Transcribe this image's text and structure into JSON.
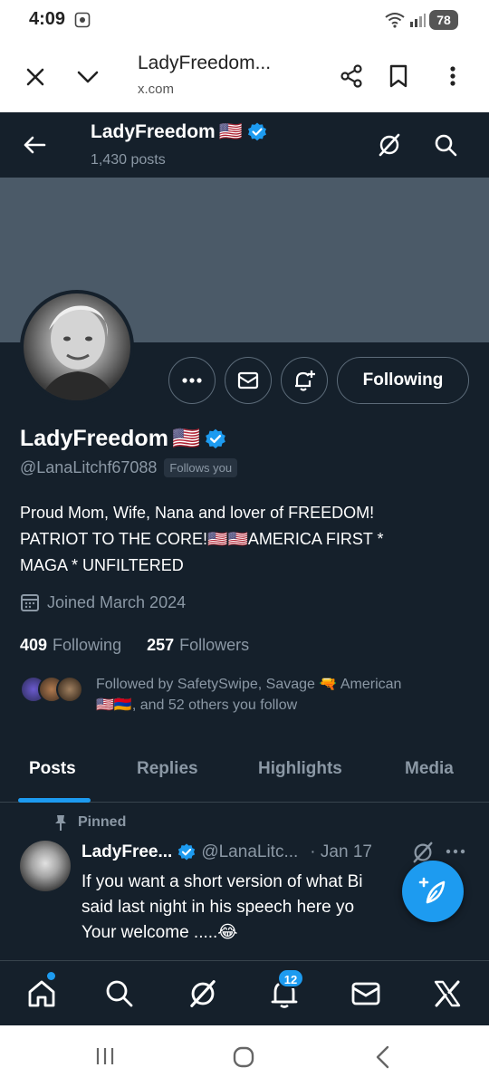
{
  "status_bar": {
    "time": "4:09",
    "battery": "78"
  },
  "browser": {
    "title": "LadyFreedom...",
    "domain": "x.com"
  },
  "top_bar": {
    "name": "LadyFreedom",
    "flag": "🇺🇸",
    "posts_count": "1,430 posts"
  },
  "profile": {
    "name": "LadyFreedom",
    "flag": "🇺🇸",
    "handle": "@LanaLitchf67088",
    "follows_you": "Follows you",
    "bio_line1": "Proud Mom, Wife, Nana and lover of FREEDOM!",
    "bio_line2": "PATRIOT TO THE CORE!🇺🇸🇺🇸AMERICA FIRST *",
    "bio_line3": "MAGA * UNFILTERED",
    "joined": "Joined March 2024",
    "following_count": "409",
    "following_label": "Following",
    "followers_count": "257",
    "followers_label": "Followers",
    "mutuals_line1": "Followed by SafetySwipe, Savage 🔫 American",
    "mutuals_line2": "🇺🇸🇦🇲, and 52 others you follow",
    "follow_button": "Following"
  },
  "tabs": [
    {
      "label": "Posts",
      "active": true
    },
    {
      "label": "Replies",
      "active": false
    },
    {
      "label": "Highlights",
      "active": false
    },
    {
      "label": "Media",
      "active": false
    }
  ],
  "pinned_post": {
    "pinned_label": "Pinned",
    "name": "LadyFree...",
    "handle": "@LanaLitc...",
    "date": "· Jan 17",
    "text_line1": "If you want a short version of what Bi",
    "text_line2": "said last night in his speech here yo",
    "text_line3": "Your welcome .....😂"
  },
  "bottom_nav": {
    "notifications_badge": "12"
  },
  "colors": {
    "background": "#15202b",
    "accent": "#1d9bf0",
    "banner": "#4b5a68",
    "muted": "#8b98a5"
  }
}
